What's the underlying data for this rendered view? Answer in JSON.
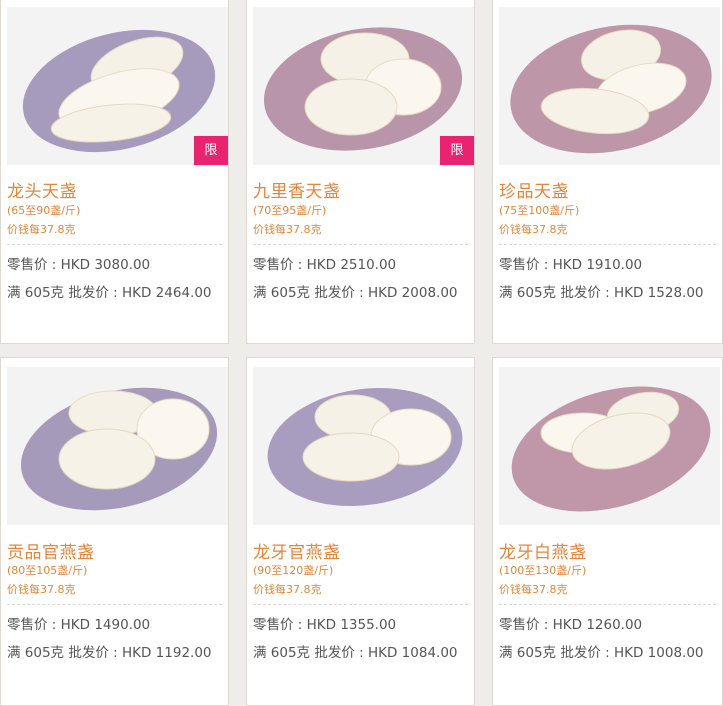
{
  "products": [
    {
      "name": "龙头天盏",
      "spec": "(65至90盏/斤)",
      "unit_price": "价钱每37.8克",
      "retail": "零售价 : HKD 3080.00",
      "wholesale": "满 605克 批发价 : HKD 2464.00",
      "badge": "限",
      "plate": "#a79bbd"
    },
    {
      "name": "九里香天盏",
      "spec": "(70至95盏/斤)",
      "unit_price": "价钱每37.8克",
      "retail": "零售价 : HKD 2510.00",
      "wholesale": "满 605克 批发价 : HKD 2008.00",
      "badge": "限",
      "plate": "#b895a8"
    },
    {
      "name": "珍品天盏",
      "spec": "(75至100盏/斤)",
      "unit_price": "价钱每37.8克",
      "retail": "零售价 : HKD 1910.00",
      "wholesale": "满 605克 批发价 : HKD 1528.00",
      "badge": "",
      "plate": "#bd96a8"
    },
    {
      "name": "贡品官燕盏",
      "spec": "(80至105盏/斤)",
      "unit_price": "价钱每37.8克",
      "retail": "零售价 : HKD 1490.00",
      "wholesale": "满 605克 批发价 : HKD 1192.00",
      "badge": "",
      "plate": "#a69abb"
    },
    {
      "name": "龙牙官燕盏",
      "spec": "(90至120盏/斤)",
      "unit_price": "价钱每37.8克",
      "retail": "零售价 : HKD 1355.00",
      "wholesale": "满 605克 批发价 : HKD 1084.00",
      "badge": "",
      "plate": "#a99dbf"
    },
    {
      "name": "龙牙白燕盏",
      "spec": "(100至130盏/斤)",
      "unit_price": "价钱每37.8克",
      "retail": "零售价 : HKD 1260.00",
      "wholesale": "满 605克 批发价 : HKD 1008.00",
      "badge": "",
      "plate": "#bf97a9"
    }
  ],
  "colors": {
    "title": "#e0873a",
    "badge": "#e8236f",
    "price": "#555555"
  }
}
